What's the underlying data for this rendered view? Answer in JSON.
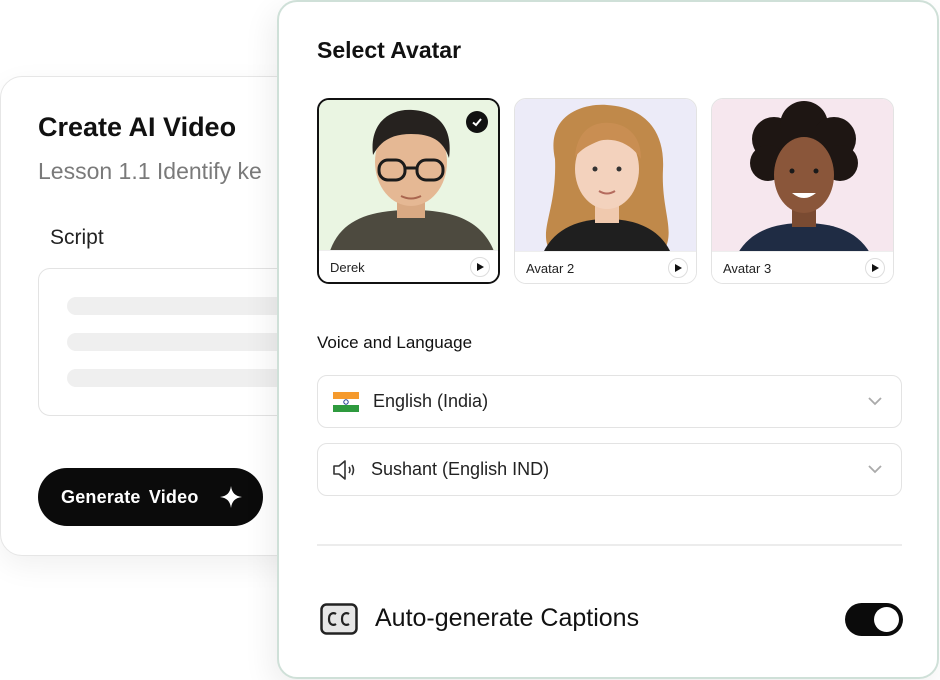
{
  "create_card": {
    "title": "Create AI Video",
    "subtitle": "Lesson 1.1 Identify ke",
    "script_label": "Script",
    "generate_button": "Generate  Video"
  },
  "avatar_panel": {
    "title": "Select Avatar",
    "avatars": [
      {
        "name": "Derek",
        "selected": true,
        "bg": "#eaf5e2"
      },
      {
        "name": "Avatar 2",
        "selected": false,
        "bg": "#ecebf8"
      },
      {
        "name": "Avatar 3",
        "selected": false,
        "bg": "#f6e7ee"
      }
    ],
    "voice_section_label": "Voice and Language",
    "language_select": {
      "value": "English (India)",
      "icon": "india-flag-icon"
    },
    "voice_select": {
      "value": "Sushant (English IND)",
      "icon": "speaker-icon"
    },
    "captions_label": "Auto-generate Captions",
    "captions_enabled": true
  },
  "colors": {
    "accent": "#0b0b0b",
    "panel_border": "#cfe0d8",
    "muted_text": "#7a7a7a"
  }
}
